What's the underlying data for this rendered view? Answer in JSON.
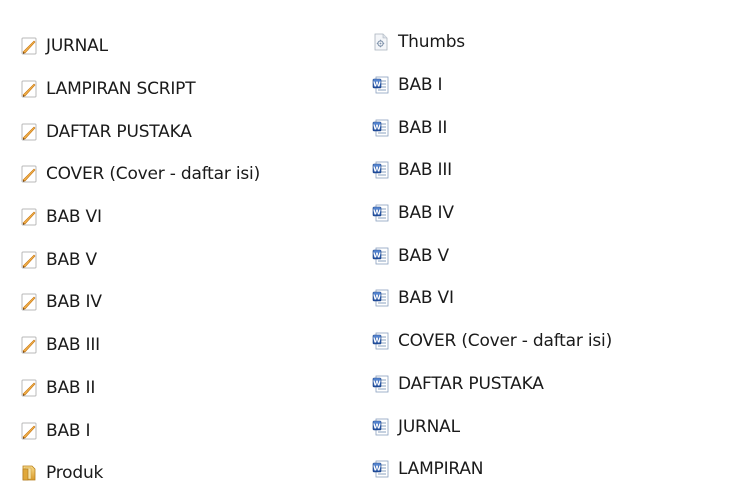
{
  "left_list": {
    "items": [
      {
        "label": "JURNAL",
        "icon": "pdf-icon"
      },
      {
        "label": "LAMPIRAN SCRIPT",
        "icon": "pdf-icon"
      },
      {
        "label": "DAFTAR PUSTAKA",
        "icon": "pdf-icon"
      },
      {
        "label": "COVER (Cover - daftar isi)",
        "icon": "pdf-icon"
      },
      {
        "label": "BAB VI",
        "icon": "pdf-icon"
      },
      {
        "label": "BAB V",
        "icon": "pdf-icon"
      },
      {
        "label": "BAB IV",
        "icon": "pdf-icon"
      },
      {
        "label": "BAB III",
        "icon": "pdf-icon"
      },
      {
        "label": "BAB II",
        "icon": "pdf-icon"
      },
      {
        "label": "BAB I",
        "icon": "pdf-icon"
      },
      {
        "label": "Produk",
        "icon": "folder-icon"
      }
    ]
  },
  "right_list": {
    "items": [
      {
        "label": "Thumbs",
        "icon": "system-file-icon"
      },
      {
        "label": "BAB I",
        "icon": "word-doc-icon"
      },
      {
        "label": "BAB II",
        "icon": "word-doc-icon"
      },
      {
        "label": "BAB III",
        "icon": "word-doc-icon"
      },
      {
        "label": "BAB IV",
        "icon": "word-doc-icon"
      },
      {
        "label": "BAB V",
        "icon": "word-doc-icon"
      },
      {
        "label": "BAB VI",
        "icon": "word-doc-icon"
      },
      {
        "label": "COVER (Cover - daftar isi)",
        "icon": "word-doc-icon"
      },
      {
        "label": "DAFTAR PUSTAKA",
        "icon": "word-doc-icon"
      },
      {
        "label": "JURNAL",
        "icon": "word-doc-icon"
      },
      {
        "label": "LAMPIRAN",
        "icon": "word-doc-icon"
      }
    ]
  },
  "colors": {
    "pdf_accent": "#f0a018",
    "word_accent": "#2a5caa",
    "folder_accent": "#e9b84a"
  }
}
